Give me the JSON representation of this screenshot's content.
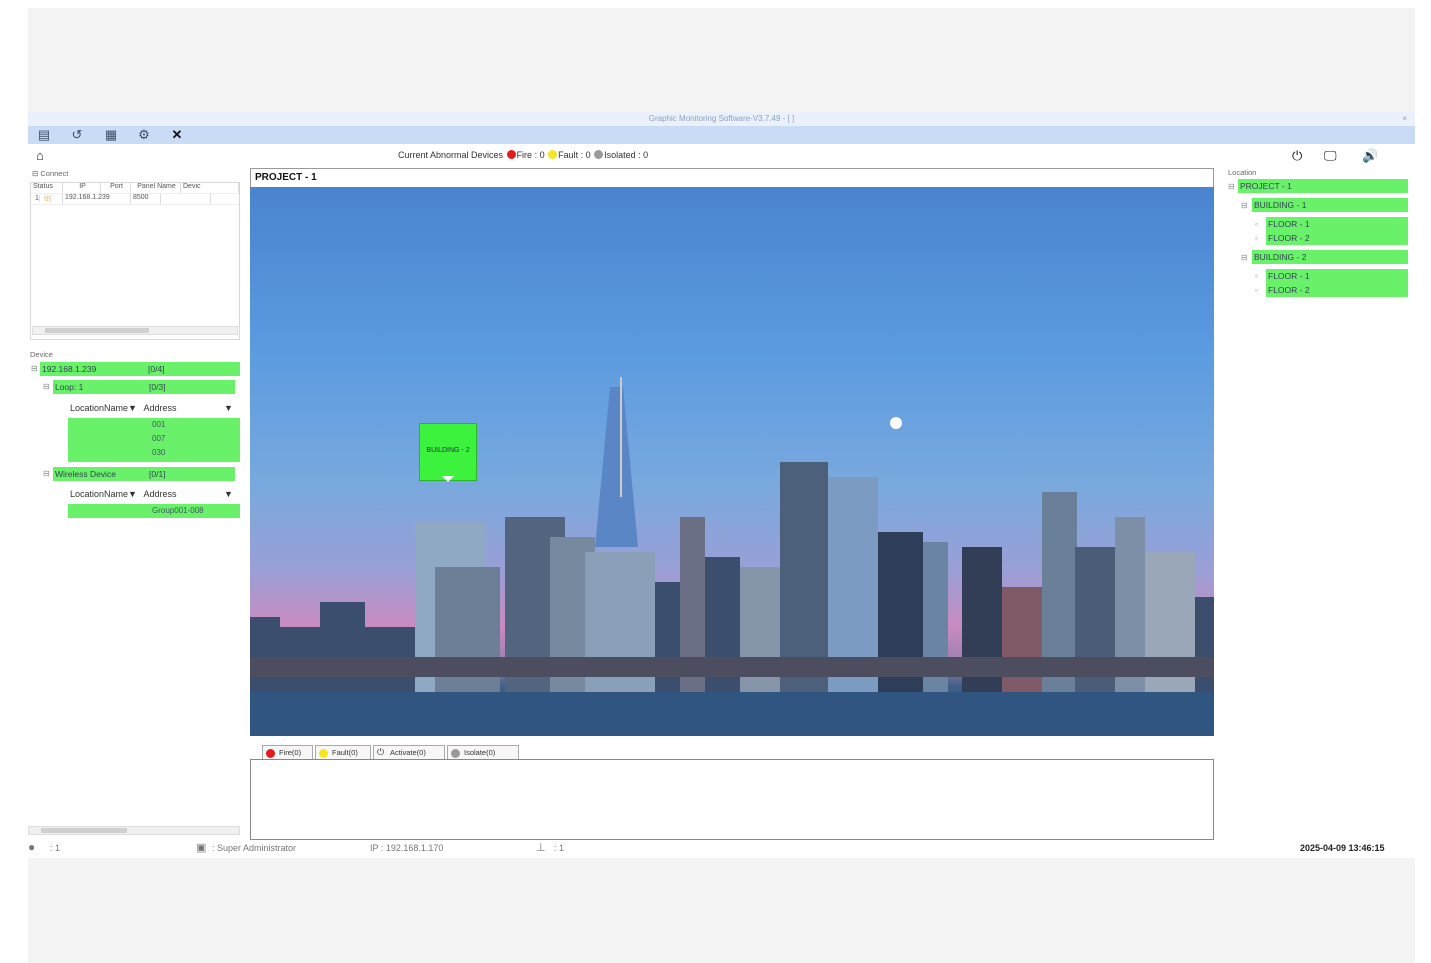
{
  "window": {
    "title": "Graphic Monitoring Software-V3.7.49 - [ ]",
    "close": "×"
  },
  "toolbar": {
    "icons": [
      "list-icon",
      "history-icon",
      "report-icon",
      "settings-icon",
      "close-icon"
    ],
    "close_glyph": "✕"
  },
  "status_line": {
    "label": "Current Abnormal Devices",
    "fire": "Fire : 0",
    "fault": "Fault : 0",
    "isolated": "Isolated : 0",
    "colors": {
      "fire": "#e41b1b",
      "fault": "#f4e81c",
      "isolated": "#9a9a9a"
    }
  },
  "connect": {
    "label": "Connect",
    "columns": [
      "Status",
      "IP",
      "Port",
      "Panel Name",
      "Devic"
    ],
    "rows": [
      {
        "index": "1",
        "ip": "192.168.1.239",
        "port": "8500"
      }
    ]
  },
  "device": {
    "label": "Device",
    "root": {
      "label": "192.168.1.239",
      "count": "[0/4]"
    },
    "loop": {
      "label": "Loop: 1",
      "count": "[0/3]"
    },
    "headers": {
      "location": "LocationName",
      "address": "Address"
    },
    "loop_addresses": [
      "001",
      "007",
      "030"
    ],
    "wireless": {
      "label": "Wireless Device",
      "count": "[0/1]"
    },
    "wireless_addresses": [
      "Group001-008"
    ]
  },
  "main": {
    "title": "PROJECT - 1",
    "marker_label": "BUILDING - 2"
  },
  "tabs": [
    {
      "label": "Fire(0)",
      "color": "#e41b1b"
    },
    {
      "label": "Fault(0)",
      "color": "#f4e81c"
    },
    {
      "label": "Activate(0)",
      "color": "#333333"
    },
    {
      "label": "Isolate(0)",
      "color": "#9a9a9a"
    }
  ],
  "location": {
    "label": "Location",
    "project": "PROJECT - 1",
    "building1": "BUILDING - 1",
    "building1_floors": [
      "FLOOR - 1",
      "FLOOR - 2"
    ],
    "building2": "BUILDING - 2",
    "building2_floors": [
      "FLOOR - 1",
      "FLOOR - 2"
    ]
  },
  "statusbar": {
    "users": ": 1",
    "role": ": Super Administrator",
    "ip": "IP : 192.168.1.170",
    "net": ": 1",
    "datetime": "2025-04-09 13:46:15"
  }
}
